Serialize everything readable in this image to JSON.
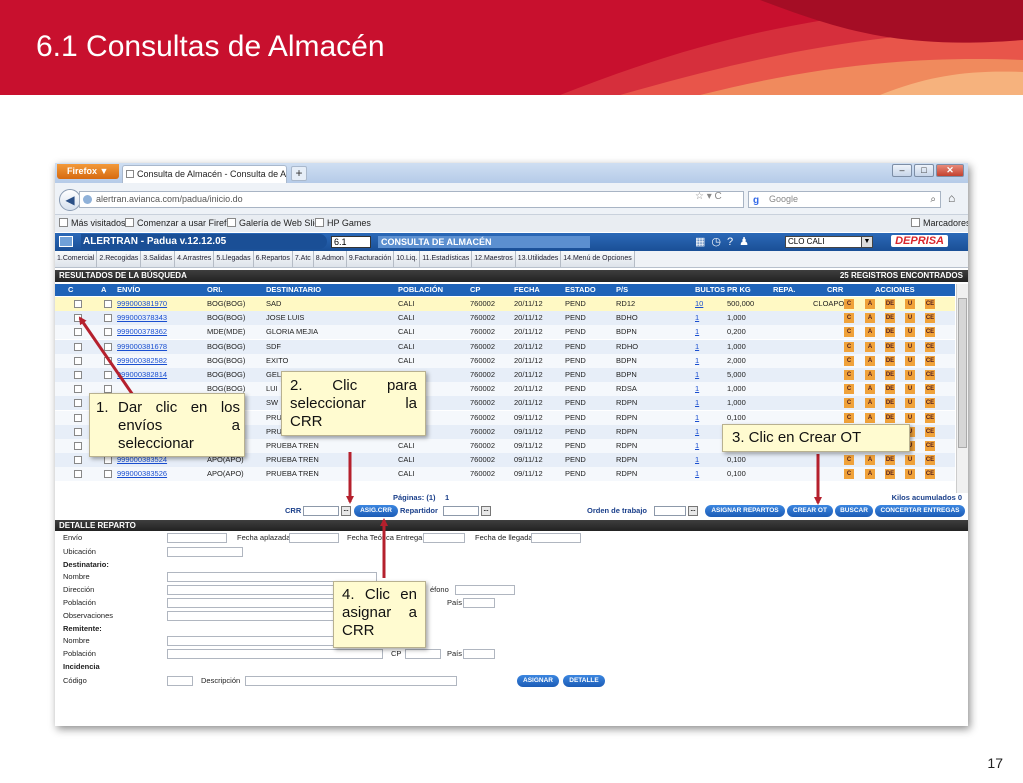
{
  "slide": {
    "title": "6.1 Consultas de Almacén",
    "page_number": "17",
    "banner_color": "#c8102e"
  },
  "browser": {
    "menu_button": "Firefox ▼",
    "tab_title": "Consulta de Almacén - Consulta de Alm...",
    "new_tab": "+",
    "url": "alertran.avianca.com/padua/inicio.do",
    "search_placeholder": "Google",
    "bookmarks": [
      "Más visitados",
      "Comenzar a usar Firefox",
      "Galería de Web Slice",
      "HP Games"
    ],
    "bookmarks_menu": "Marcadores"
  },
  "app": {
    "title": "ALERTRAN - Padua  v.12.12.05",
    "screen_code": "6.1",
    "section": "CONSULTA DE ALMACÉN",
    "office": "CLO CALI",
    "logo": "DEPRISA",
    "accent": "#1f63b8"
  },
  "menu": [
    "1.Comercial",
    "2.Recogidas",
    "3.Salidas",
    "4.Arrastres",
    "5.Llegadas",
    "6.Repartos",
    "7.Atc",
    "8.Admon",
    "9.Facturación",
    "10.Liq.",
    "11.Estadísticas",
    "12.Maestros",
    "13.Utilidades",
    "14.Menú de Opciones"
  ],
  "results": {
    "header": "RESULTADOS DE LA BÚSQUEDA",
    "count": "25 REGISTROS ENCONTRADOS",
    "columns": [
      "C",
      "A",
      "ENVÍO",
      "ORI.",
      "DESTINATARIO",
      "POBLACIÓN",
      "CP",
      "FECHA",
      "ESTADO",
      "P/S",
      "BULTOS",
      "PR KG",
      "REPA.",
      "CRR",
      "ACCIONES"
    ],
    "actions": [
      "C",
      "A",
      "DE",
      "U",
      "CE"
    ],
    "rows": [
      {
        "envio": "999000381970",
        "ori": "BOG(BOG)",
        "dest": "SAD",
        "pob": "CALI",
        "cp": "760002",
        "fecha": "20/11/12",
        "estado": "PEND",
        "ps": "RD12",
        "bultos": "10",
        "kg": "500,000",
        "crr": "CLOAPO"
      },
      {
        "envio": "999000378343",
        "ori": "BOG(BOG)",
        "dest": "JOSE LUIS",
        "pob": "CALI",
        "cp": "760002",
        "fecha": "20/11/12",
        "estado": "PEND",
        "ps": "BDHO",
        "bultos": "1",
        "kg": "1,000",
        "crr": ""
      },
      {
        "envio": "999000378362",
        "ori": "MDE(MDE)",
        "dest": "GLORIA MEJIA",
        "pob": "CALI",
        "cp": "760002",
        "fecha": "20/11/12",
        "estado": "PEND",
        "ps": "BDPN",
        "bultos": "1",
        "kg": "0,200",
        "crr": ""
      },
      {
        "envio": "999000381678",
        "ori": "BOG(BOG)",
        "dest": "SDF",
        "pob": "CALI",
        "cp": "760002",
        "fecha": "20/11/12",
        "estado": "PEND",
        "ps": "RDHO",
        "bultos": "1",
        "kg": "1,000",
        "crr": ""
      },
      {
        "envio": "999000382582",
        "ori": "BOG(BOG)",
        "dest": "EXITO",
        "pob": "CALI",
        "cp": "760002",
        "fecha": "20/11/12",
        "estado": "PEND",
        "ps": "BDPN",
        "bultos": "1",
        "kg": "2,000",
        "crr": ""
      },
      {
        "envio": "999000382814",
        "ori": "BOG(BOG)",
        "dest": "GEL",
        "pob": "CALI",
        "cp": "760002",
        "fecha": "20/11/12",
        "estado": "PEND",
        "ps": "BDPN",
        "bultos": "1",
        "kg": "5,000",
        "crr": ""
      },
      {
        "envio": "",
        "ori": "BOG(BOG)",
        "dest": "LUI",
        "pob": "CALI",
        "cp": "760002",
        "fecha": "20/11/12",
        "estado": "PEND",
        "ps": "RDSA",
        "bultos": "1",
        "kg": "1,000",
        "crr": ""
      },
      {
        "envio": "",
        "ori": "",
        "dest": "SW",
        "pob": "CALI",
        "cp": "760002",
        "fecha": "20/11/12",
        "estado": "PEND",
        "ps": "RDPN",
        "bultos": "1",
        "kg": "1,000",
        "crr": ""
      },
      {
        "envio": "",
        "ori": "",
        "dest": "PRU",
        "pob": "CALI",
        "cp": "760002",
        "fecha": "09/11/12",
        "estado": "PEND",
        "ps": "RDPN",
        "bultos": "1",
        "kg": "0,100",
        "crr": ""
      },
      {
        "envio": "",
        "ori": "",
        "dest": "PRU",
        "pob": "CALI",
        "cp": "760002",
        "fecha": "09/11/12",
        "estado": "PEND",
        "ps": "RDPN",
        "bultos": "1",
        "kg": "0,100",
        "crr": ""
      },
      {
        "envio": "",
        "ori": "",
        "dest": "PRUEBA TREN",
        "pob": "CALI",
        "cp": "760002",
        "fecha": "09/11/12",
        "estado": "PEND",
        "ps": "RDPN",
        "bultos": "1",
        "kg": "0,100",
        "crr": ""
      },
      {
        "envio": "999000383524",
        "ori": "APO(APO)",
        "dest": "PRUEBA TREN",
        "pob": "CALI",
        "cp": "760002",
        "fecha": "09/11/12",
        "estado": "PEND",
        "ps": "RDPN",
        "bultos": "1",
        "kg": "0,100",
        "crr": ""
      },
      {
        "envio": "999000383526",
        "ori": "APO(APO)",
        "dest": "PRUEBA TREN",
        "pob": "CALI",
        "cp": "760002",
        "fecha": "09/11/12",
        "estado": "PEND",
        "ps": "RDPN",
        "bultos": "1",
        "kg": "0,100",
        "crr": ""
      }
    ],
    "paginas_label": "Páginas: (1)",
    "paginas_current": "1",
    "kilos": "Kilos acumulados 0"
  },
  "toolbar": {
    "crr_label": "CRR",
    "asig_crr": "ASIG.CRR",
    "repartidor_label": "Repartidor",
    "orden_label": "Orden de trabajo",
    "asignar_repartos": "ASIGNAR REPARTOS",
    "crear_ot": "CREAR OT",
    "buscar": "BUSCAR",
    "concertar": "CONCERTAR ENTREGAS",
    "more": "..."
  },
  "detail": {
    "header": "DETALLE REPARTO",
    "envio": "Envío",
    "fecha_aplazada": "Fecha aplazada",
    "fecha_teorica": "Fecha Teórica Entrega",
    "fecha_llegada": "Fecha de llegada",
    "ubicacion": "Ubicación",
    "destinatario": "Destinatario:",
    "nombre": "Nombre",
    "direccion": "Dirección",
    "telefono": "éfono",
    "poblacion": "Población",
    "pais": "País",
    "observaciones": "Observaciones",
    "remitente": "Remitente:",
    "cp": "CP",
    "incidencia": "Incidencia",
    "codigo": "Código",
    "descripcion": "Descripción",
    "asignar": "ASIGNAR",
    "detalle": "DETALLE"
  },
  "callouts": {
    "c1_num": "1.",
    "c1_text": "Dar clic en los envíos a seleccionar",
    "c2_text": "2. Clic para seleccionar la CRR",
    "c3_text": "3. Clic en Crear OT",
    "c4_text": "4. Clic en asignar a CRR",
    "arrow_color": "#b5202d"
  }
}
